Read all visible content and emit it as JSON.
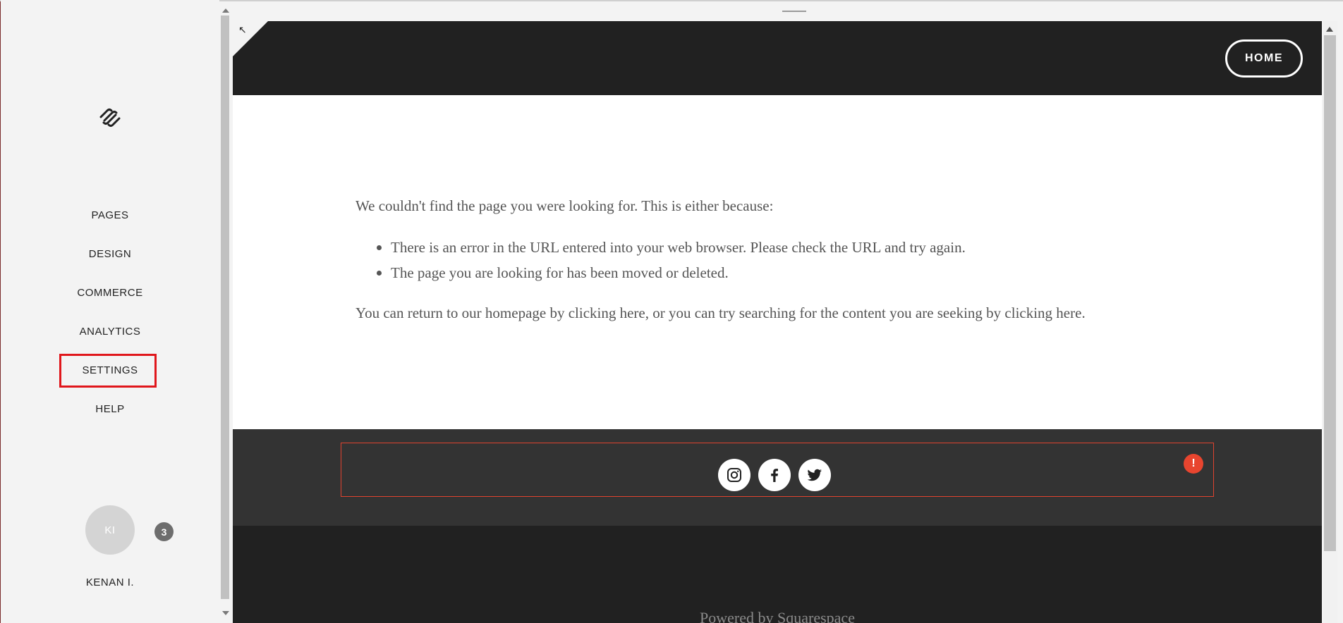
{
  "sidebar": {
    "nav": [
      {
        "label": "PAGES"
      },
      {
        "label": "DESIGN"
      },
      {
        "label": "COMMERCE"
      },
      {
        "label": "ANALYTICS"
      },
      {
        "label": "SETTINGS"
      },
      {
        "label": "HELP"
      }
    ],
    "highlighted_item": "SETTINGS",
    "highlight_color": "#e0161b",
    "user": {
      "initials": "KI",
      "name": "KENAN I.",
      "notification_count": "3"
    }
  },
  "site": {
    "header_button": "HOME",
    "error": {
      "intro": "We couldn't find the page you were looking for. This is either because:",
      "reasons": [
        "There is an error in the URL entered into your web browser. Please check the URL and try again.",
        "The page you are looking for has been moved or deleted."
      ],
      "return_text": "You can return to our homepage by clicking here, or you can try searching for the content you are seeking by clicking here."
    },
    "social": [
      "instagram-icon",
      "facebook-icon",
      "twitter-icon"
    ],
    "warning_label": "!",
    "footer_text": "Powered by Squarespace"
  },
  "colors": {
    "header_bg": "#212121",
    "footer_bg": "#333333",
    "accent_warning": "#e8452f"
  }
}
